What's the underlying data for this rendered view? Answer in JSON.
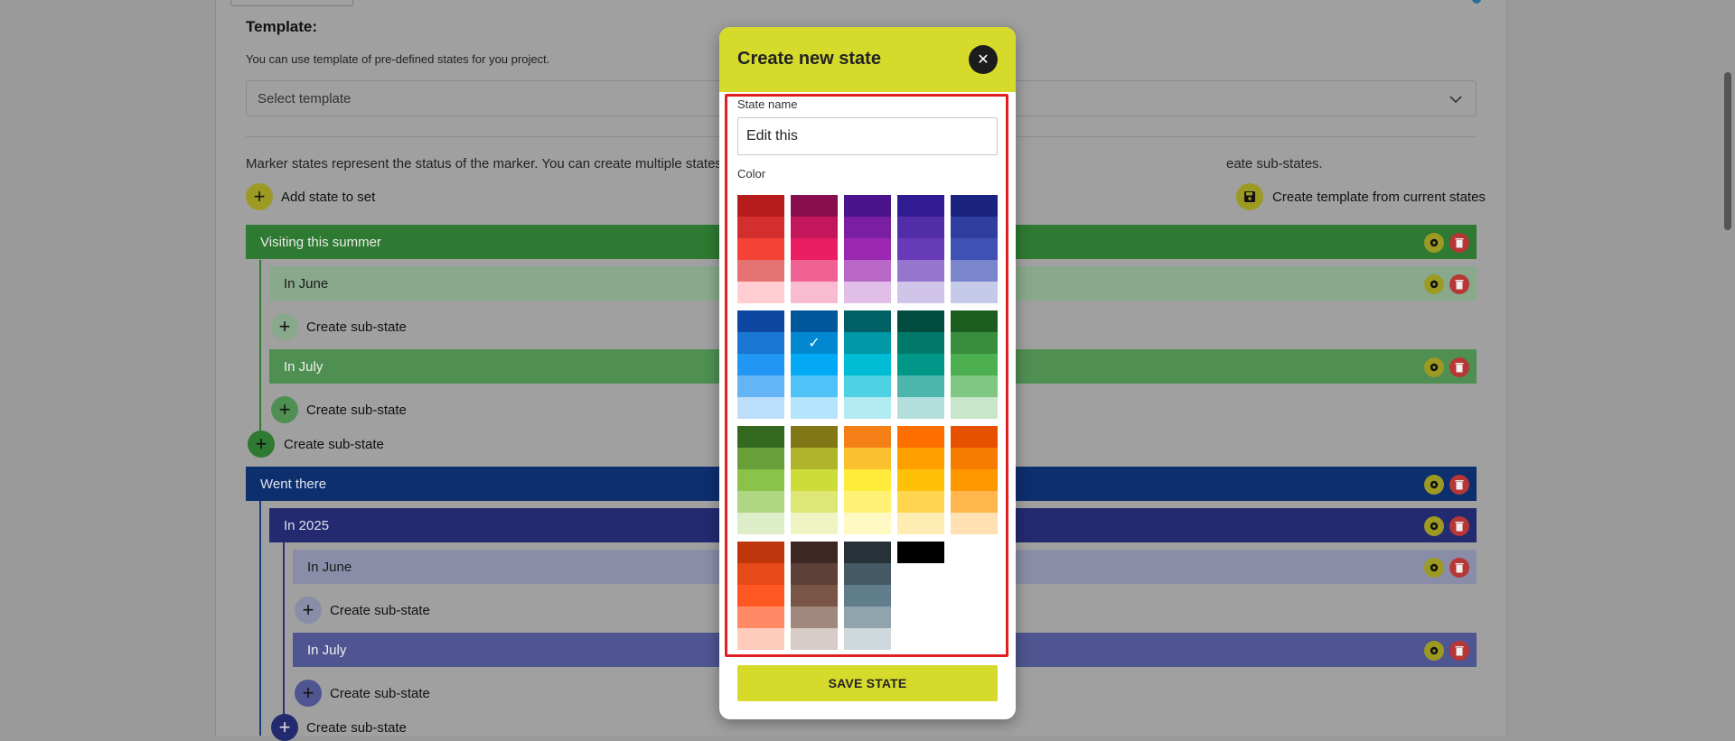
{
  "template": {
    "title": "Template:",
    "help": "You can use template of pre-defined states for you project.",
    "select_placeholder": "Select template"
  },
  "description_left": "Marker states represent the status of the marker. You can create multiple states wit",
  "description_right": "eate sub-states.",
  "toolbar": {
    "add_state_label": "Add state to set",
    "create_template_label": "Create template from current states"
  },
  "states": [
    {
      "label": "Visiting this summer"
    },
    {
      "label": "In June"
    },
    {
      "label": "Create sub-state"
    },
    {
      "label": "In July"
    },
    {
      "label": "Create sub-state"
    },
    {
      "label": "Create sub-state"
    },
    {
      "label": "Went there"
    },
    {
      "label": "In 2025"
    },
    {
      "label": "In June"
    },
    {
      "label": "Create sub-state"
    },
    {
      "label": "In July"
    },
    {
      "label": "Create sub-state"
    },
    {
      "label": "Create sub-state"
    }
  ],
  "modal": {
    "title": "Create new state",
    "close_icon": "close-icon",
    "state_name_label": "State name",
    "state_name_value": "Edit this",
    "color_label": "Color",
    "save_label": "SAVE STATE",
    "selected_color": "#03a9f4",
    "palette": [
      [
        "#b71c1c",
        "#d32f2f",
        "#f44336",
        "#e57373",
        "#ffcdd2"
      ],
      [
        "#880e4f",
        "#c2185b",
        "#e91e63",
        "#f06292",
        "#f8bbd0"
      ],
      [
        "#4a148c",
        "#7b1fa2",
        "#9c27b0",
        "#ba68c8",
        "#e1bee7"
      ],
      [
        "#311b92",
        "#512da8",
        "#673ab7",
        "#9575cd",
        "#d1c4e9"
      ],
      [
        "#1a237e",
        "#303f9f",
        "#3f51b5",
        "#7986cb",
        "#c5cae9"
      ],
      [
        "#0d47a1",
        "#1976d2",
        "#2196f3",
        "#64b5f6",
        "#bbdefb"
      ],
      [
        "#01579b",
        "#0288d1",
        "#03a9f4",
        "#4fc3f7",
        "#b3e5fc"
      ],
      [
        "#006064",
        "#0097a7",
        "#00bcd4",
        "#4dd0e1",
        "#b2ebf2"
      ],
      [
        "#004d40",
        "#00796b",
        "#009688",
        "#4db6ac",
        "#b2dfdb"
      ],
      [
        "#1b5e20",
        "#388e3c",
        "#4caf50",
        "#81c784",
        "#c8e6c9"
      ],
      [
        "#33691e",
        "#689f38",
        "#8bc34a",
        "#aed581",
        "#dcedc8"
      ],
      [
        "#827717",
        "#afb42b",
        "#cddc39",
        "#dce775",
        "#f0f4c3"
      ],
      [
        "#f57f17",
        "#fbc02d",
        "#ffeb3b",
        "#fff176",
        "#fff9c4"
      ],
      [
        "#ff6f00",
        "#ffa000",
        "#ffc107",
        "#ffd54f",
        "#ffecb3"
      ],
      [
        "#e65100",
        "#f57c00",
        "#ff9800",
        "#ffb74d",
        "#ffe0b2"
      ],
      [
        "#bf360c",
        "#e64a19",
        "#ff5722",
        "#ff8a65",
        "#ffccbc"
      ],
      [
        "#3e2723",
        "#5d4037",
        "#795548",
        "#a1887f",
        "#d7ccc8"
      ],
      [
        "#263238",
        "#455a64",
        "#607d8b",
        "#90a4ae",
        "#cfd8dc"
      ],
      [
        "#000000"
      ]
    ]
  },
  "colors": {
    "accent": "#d6db2b",
    "highlight": "#e02020"
  }
}
